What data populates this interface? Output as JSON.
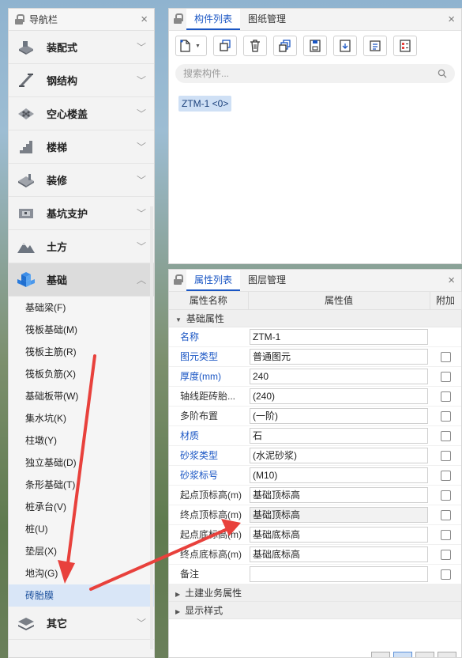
{
  "nav": {
    "title": "导航栏",
    "categories": [
      {
        "label": "装配式",
        "icon": "prefab-icon"
      },
      {
        "label": "钢结构",
        "icon": "steel-beam-icon"
      },
      {
        "label": "空心楼盖",
        "icon": "hollow-slab-icon"
      },
      {
        "label": "楼梯",
        "icon": "stairs-icon"
      },
      {
        "label": "装修",
        "icon": "decoration-icon"
      },
      {
        "label": "基坑支护",
        "icon": "pit-support-icon"
      },
      {
        "label": "土方",
        "icon": "earthwork-icon"
      },
      {
        "label": "基础",
        "icon": "foundation-icon"
      }
    ],
    "sub_items": [
      "基础梁(F)",
      "筏板基础(M)",
      "筏板主筋(R)",
      "筏板负筋(X)",
      "基础板带(W)",
      "集水坑(K)",
      "柱墩(Y)",
      "独立基础(D)",
      "条形基础(T)",
      "桩承台(V)",
      "桩(U)",
      "垫层(X)",
      "地沟(G)",
      "砖胎膜"
    ],
    "selected_sub": "砖胎膜",
    "last_category": {
      "label": "其它",
      "icon": "other-icon"
    }
  },
  "component_panel": {
    "tabs": [
      "构件列表",
      "图纸管理"
    ],
    "search_placeholder": "搜索构件...",
    "items": [
      "ZTM-1 <0>"
    ]
  },
  "property_panel": {
    "tabs": [
      "属性列表",
      "图层管理"
    ],
    "columns": [
      "属性名称",
      "属性值",
      "附加"
    ],
    "group_basic": "基础属性",
    "rows": [
      {
        "name": "名称",
        "value": "ZTM-1",
        "blue": true,
        "checkbox": false
      },
      {
        "name": "图元类型",
        "value": "普通图元",
        "blue": true,
        "checkbox": true
      },
      {
        "name": "厚度(mm)",
        "value": "240",
        "blue": true,
        "checkbox": true
      },
      {
        "name": "轴线距砖胎...",
        "value": "(240)",
        "blue": false,
        "checkbox": true
      },
      {
        "name": "多阶布置",
        "value": "(一阶)",
        "blue": false,
        "checkbox": true
      },
      {
        "name": "材质",
        "value": "石",
        "blue": true,
        "checkbox": true
      },
      {
        "name": "砂浆类型",
        "value": "(水泥砂浆)",
        "blue": true,
        "checkbox": true
      },
      {
        "name": "砂浆标号",
        "value": "(M10)",
        "blue": true,
        "checkbox": true
      },
      {
        "name": "起点顶标高(m)",
        "value": "基础顶标高",
        "blue": false,
        "checkbox": true
      },
      {
        "name": "终点顶标高(m)",
        "value": "基础顶标高",
        "blue": false,
        "checkbox": true
      },
      {
        "name": "起点底标高(m)",
        "value": "基础底标高",
        "blue": false,
        "checkbox": true
      },
      {
        "name": "终点底标高(m)",
        "value": "基础底标高",
        "blue": false,
        "checkbox": true
      },
      {
        "name": "备注",
        "value": "",
        "blue": false,
        "checkbox": true
      }
    ],
    "group_civil": "土建业务属性",
    "group_display": "显示样式"
  },
  "colors": {
    "accent": "#1a56c4",
    "annotation_arrow": "#e8413c"
  }
}
